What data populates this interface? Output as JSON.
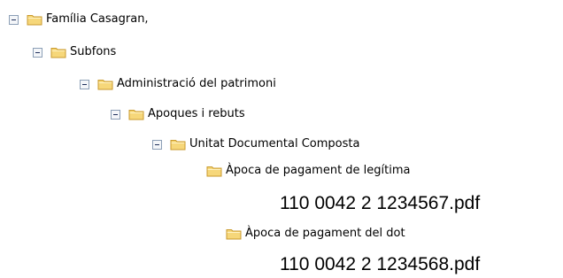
{
  "tree": {
    "root": {
      "label": "Família Casagran,"
    },
    "subfons": {
      "label": "Subfons"
    },
    "admin": {
      "label": "Administració del patrimoni"
    },
    "apoques": {
      "label": "Apoques i rebuts"
    },
    "unitat": {
      "label": "Unitat Documental Composta"
    },
    "apoca_legitima": {
      "label": "Àpoca de pagament de legítima",
      "file": "110 0042 2 1234567.pdf"
    },
    "apoca_dot": {
      "label": "Àpoca de pagament del dot",
      "file": "110 0042 2 1234568.pdf"
    }
  },
  "colors": {
    "folder_fill": "#f6d77a",
    "folder_stroke": "#c99a2c",
    "toggle_border": "#8c9fb6"
  },
  "icons": {
    "folder": "folder-icon",
    "collapse": "collapse-icon"
  }
}
